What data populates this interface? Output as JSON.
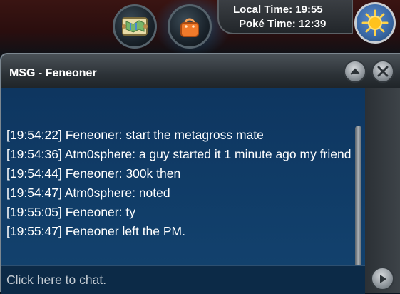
{
  "hud": {
    "local_time_label": "Local Time:",
    "local_time_value": "19:55",
    "poke_time_label": "Poké Time:",
    "poke_time_value": "12:39",
    "buttons": [
      {
        "icon": "map-icon"
      },
      {
        "icon": "bag-icon"
      },
      {
        "icon": "sun-icon"
      }
    ]
  },
  "chat": {
    "title": "MSG - Feneoner",
    "messages": [
      "[19:54:22] Feneoner: start the metagross mate",
      "[19:54:36] Atm0sphere: a guy started it 1 minute ago my friend",
      "[19:54:44] Feneoner: 300k then",
      "[19:54:47] Atm0sphere: noted",
      "[19:55:05] Feneoner: ty",
      "[19:55:47] Feneoner left the PM."
    ],
    "input_placeholder": "Click here to chat.",
    "icons": {
      "minimize": "chevron-up-icon",
      "close": "close-icon",
      "send": "play-icon"
    }
  },
  "colors": {
    "chat_background": "#0f3b66",
    "header_background": "#2c3237",
    "text": "#ffffff",
    "accent_glow": "#3cd2ff",
    "bag_orange": "#f07a2a"
  }
}
